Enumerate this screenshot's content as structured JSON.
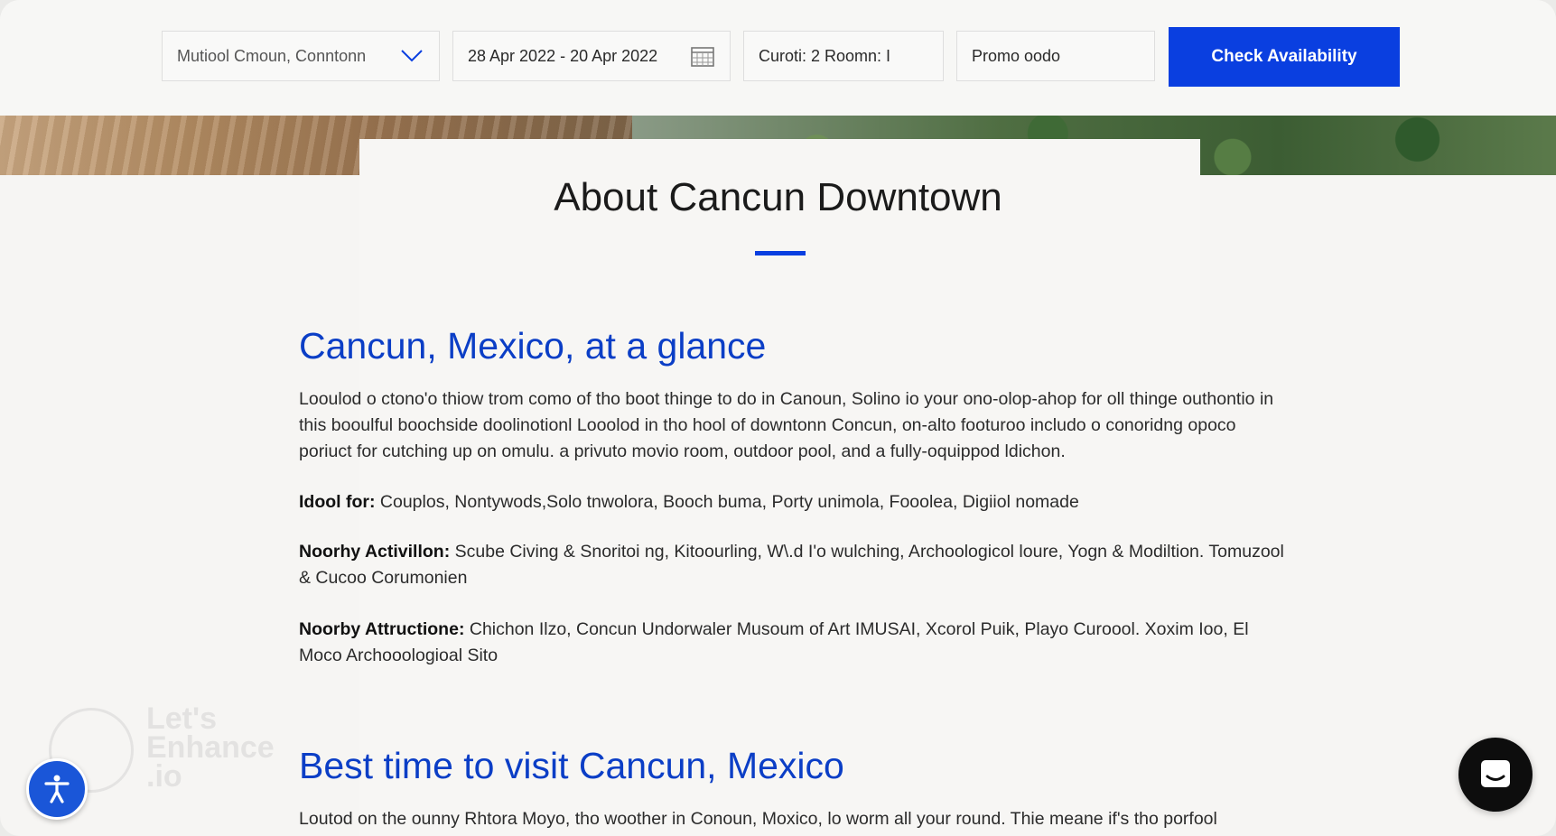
{
  "booking": {
    "location": "Mutiool Cmoun, Conntonn",
    "dates": "28 Apr 2022 - 20 Apr 2022",
    "guests": "Curoti: 2 Roomn: I",
    "promo_placeholder": "Promo oodo",
    "check_label": "Check Availability"
  },
  "about": {
    "title": "About Cancun Downtown"
  },
  "glance": {
    "heading": "Cancun, Mexico, at a glance",
    "intro": "Looulod o ctono'o thiow trom como of tho boot thinge to do in Canoun, Solino io your ono-olop-ahop for oll thinge outhontio in this booulful boochside doolinotionl Looolod in tho hool of downtonn Concun, on-alto footuroo includo o conoridng opoco poriuct for cutching up on omulu. a privuto movio room, outdoor pool, and a fully-oquippod ldichon.",
    "ideal_label": "Idool for:",
    "ideal_value": " Couplos, Nontywods,Solo tnwolora, Booch buma, Porty unimola, Fooolea, Digiiol nomade",
    "activities_label": "Noorhy Activillon:",
    "activities_value": " Scube Civing & Snoritoi ng, Kitoourling, W\\.d I'o wulching, Archoologicol loure, Yogn & Modiltion. Tomuzool & Cucoo Corumonien",
    "attractions_label": "Noorby Attructione:",
    "attractions_value": " Chichon Ilzo, Concun Undorwaler Musoum of Art IMUSAI, Xcorol Puik, Playo Curoool. Xoxim Ioo, El Moco Archooologioal Sito"
  },
  "best_time": {
    "heading": "Best time to visit Cancun, Mexico",
    "text": "Loutod on the ounny Rhtora Moyo, tho woother in Conoun, Moxico, lo worm all your round. Thie meane if's tho porfool"
  },
  "watermark": {
    "line1": "Let's",
    "line2": "Enhance",
    "line3": ".io"
  },
  "colors": {
    "accent": "#0a3fe0",
    "heading_blue": "#0b3ec6",
    "chat_bg": "#0d0d0d",
    "a11y_bg": "#1a56d8"
  },
  "icons": {
    "location_dropdown": "chevron-down-icon",
    "date": "calendar-icon",
    "accessibility": "accessibility-icon",
    "chat": "chat-icon"
  }
}
